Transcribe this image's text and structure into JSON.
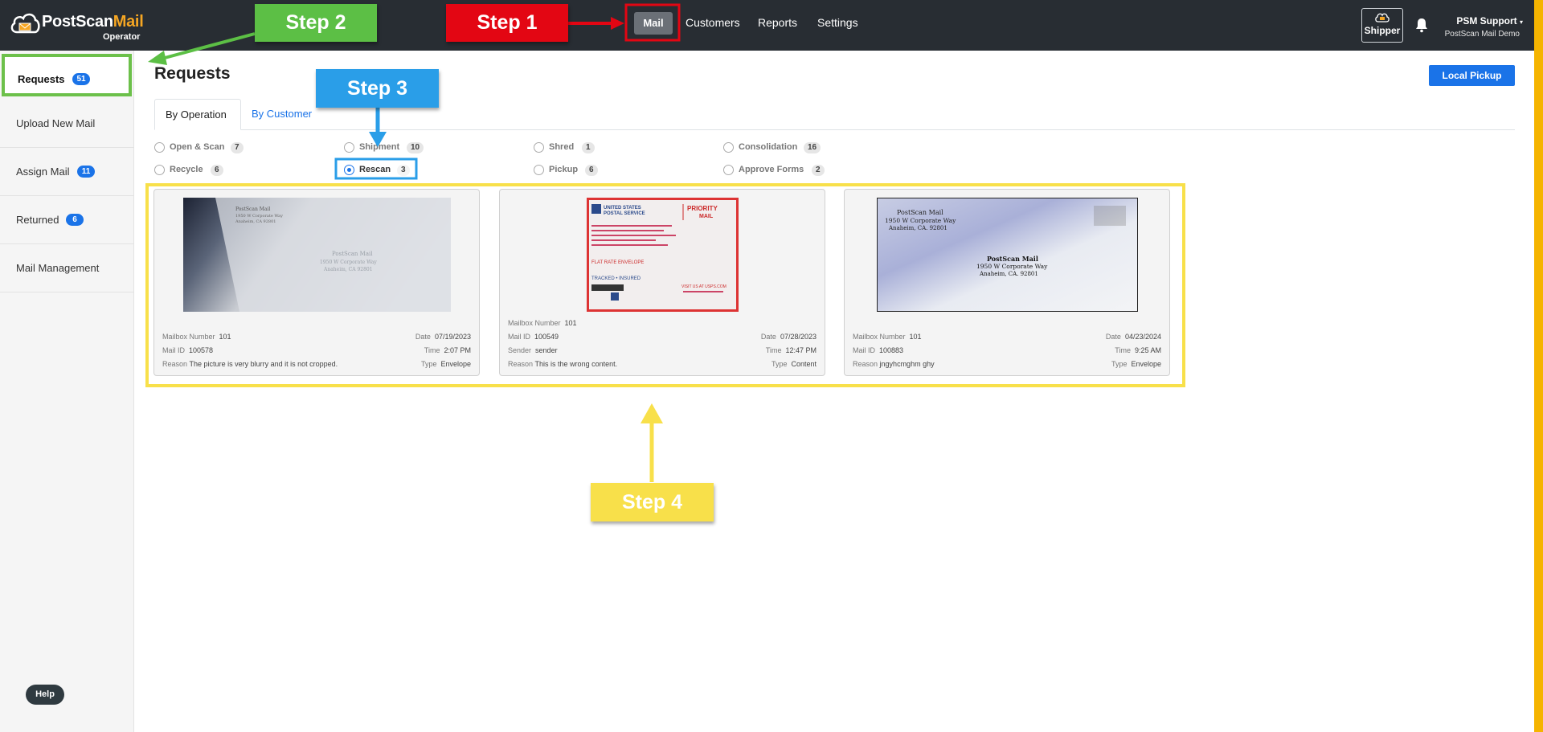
{
  "app": {
    "brand_part1": "PostScan",
    "brand_part2": "Mail",
    "role": "Operator"
  },
  "nav": {
    "mail": "Mail",
    "customers": "Customers",
    "reports": "Reports",
    "settings": "Settings"
  },
  "toolbar": {
    "shipper": "Shipper",
    "user_name": "PSM Support",
    "user_org": "PostScan Mail Demo"
  },
  "sidebar": {
    "items": [
      {
        "label": "Requests",
        "badge": "51"
      },
      {
        "label": "Upload New Mail",
        "badge": ""
      },
      {
        "label": "Assign Mail",
        "badge": "11"
      },
      {
        "label": "Returned",
        "badge": "6"
      },
      {
        "label": "Mail Management",
        "badge": ""
      }
    ],
    "help": "Help"
  },
  "main": {
    "title": "Requests",
    "local_pickup": "Local Pickup",
    "tabs": [
      "By Operation",
      "By Customer"
    ],
    "filters": [
      {
        "label": "Open & Scan",
        "count": "7",
        "checked": false
      },
      {
        "label": "Shipment",
        "count": "10",
        "checked": false
      },
      {
        "label": "Shred",
        "count": "1",
        "checked": false
      },
      {
        "label": "Consolidation",
        "count": "16",
        "checked": false
      },
      {
        "label": "Recycle",
        "count": "6",
        "checked": false
      },
      {
        "label": "Rescan",
        "count": "3",
        "checked": true
      },
      {
        "label": "Pickup",
        "count": "6",
        "checked": false
      },
      {
        "label": "Approve Forms",
        "count": "2",
        "checked": false
      }
    ]
  },
  "cards": [
    {
      "labels": {
        "mailbox": "Mailbox Number",
        "mail_id": "Mail ID",
        "reason": "Reason",
        "date": "Date",
        "time": "Time",
        "type": "Type"
      },
      "mailbox": "101",
      "mail_id": "100578",
      "reason": "The picture is very blurry and it is not cropped.",
      "date": "07/19/2023",
      "time": "2:07 PM",
      "type": "Envelope",
      "image_text": {
        "line1": "PostScan Mail",
        "line2": "1950 W Corporate Way",
        "line3": "Anaheim, CA 92801"
      }
    },
    {
      "labels": {
        "mailbox": "Mailbox Number",
        "mail_id": "Mail ID",
        "sender": "Sender",
        "reason": "Reason",
        "date": "Date",
        "time": "Time",
        "type": "Type"
      },
      "mailbox": "101",
      "mail_id": "100549",
      "sender": "sender",
      "reason": "This is the wrong content.",
      "date": "07/28/2023",
      "time": "12:47 PM",
      "type": "Content",
      "image_text": {
        "line1": "UNITED STATES",
        "line2": "POSTAL SERVICE",
        "line3": "PRIORITY",
        "line4": "MAIL",
        "line5": "FLAT RATE ENVELOPE",
        "line6": "TRACKED • INSURED",
        "line7": "VISIT US AT USPS.COM"
      }
    },
    {
      "labels": {
        "mailbox": "Mailbox Number",
        "mail_id": "Mail ID",
        "reason": "Reason",
        "date": "Date",
        "time": "Time",
        "type": "Type"
      },
      "mailbox": "101",
      "mail_id": "100883",
      "reason": "jngyhcmghm ghy",
      "date": "04/23/2024",
      "time": "9:25 AM",
      "type": "Envelope",
      "image_text": {
        "line1": "PostScan Mail",
        "line2": "1950 W Corporate Way",
        "line3": "Anaheim, CA. 92801"
      }
    }
  ],
  "annotations": {
    "step1": "Step 1",
    "step2": "Step 2",
    "step3": "Step 3",
    "step4": "Step 4"
  },
  "colors": {
    "topbar": "#282d33",
    "accent_blue": "#1a73e8",
    "step1": "#e30613",
    "step2": "#5cbf45",
    "step3": "#2a9ee8",
    "step4": "#f8e04a",
    "brand_orange": "#f5a623"
  }
}
